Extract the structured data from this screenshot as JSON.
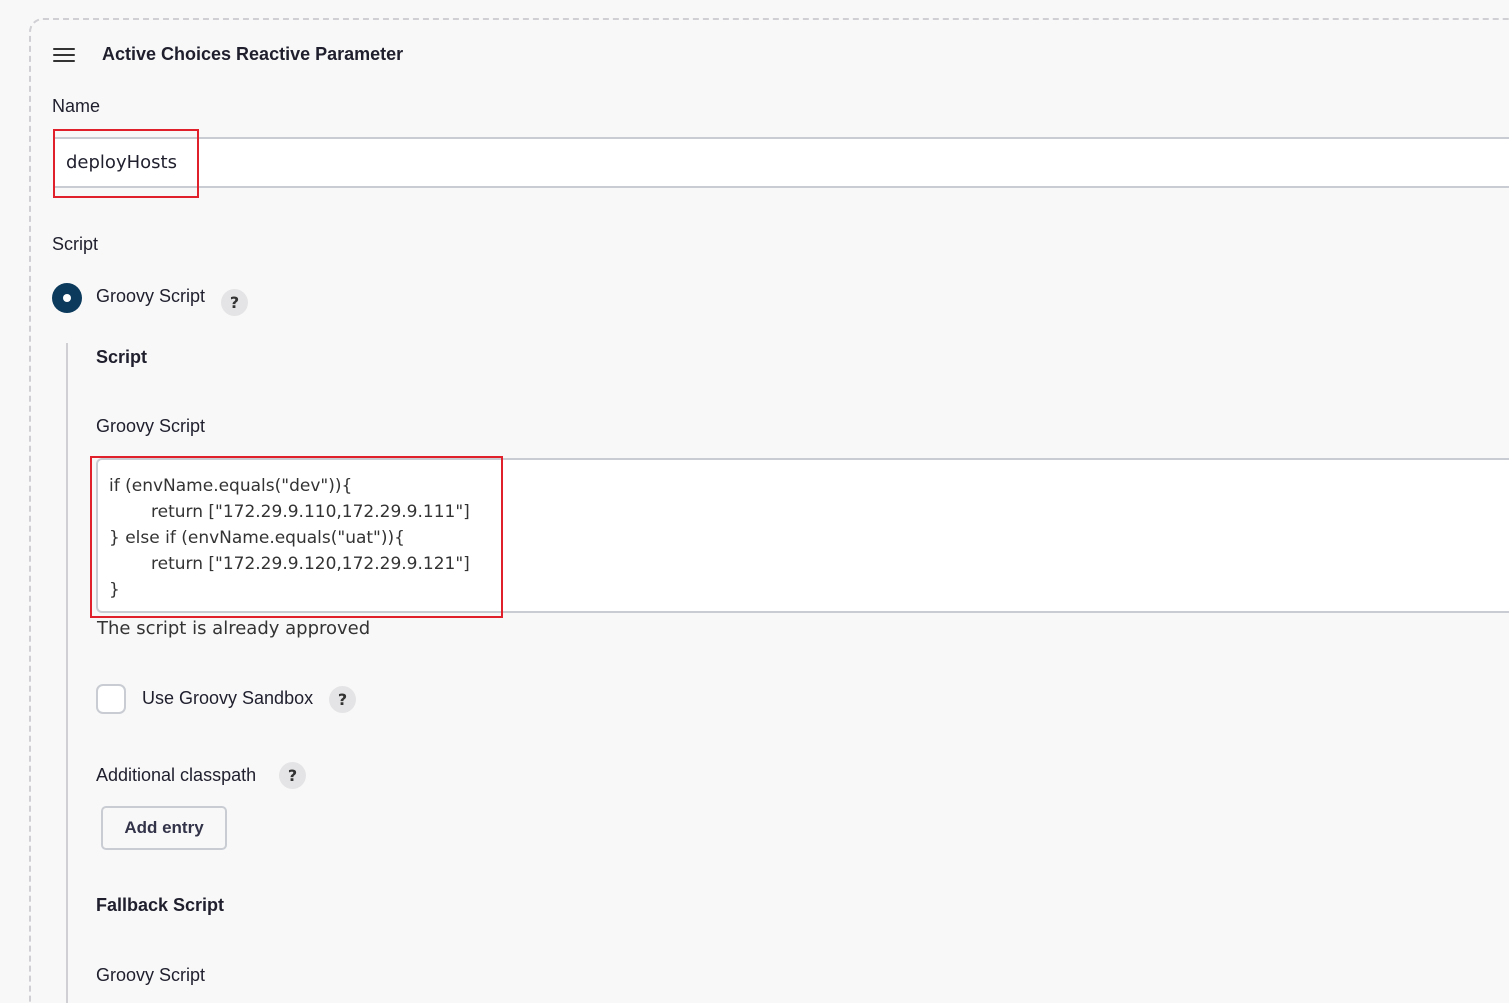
{
  "header": {
    "title": "Active Choices Reactive Parameter",
    "drag_icon": "hamburger-icon"
  },
  "name_field": {
    "label": "Name",
    "value": "deployHosts"
  },
  "script_section": {
    "label": "Script",
    "radio_label": "Groovy Script",
    "help_glyph": "?"
  },
  "groovy": {
    "section_title": "Script",
    "field_label": "Groovy Script",
    "code_lines": [
      "if (envName.equals(\"dev\")){",
      "return [\"172.29.9.110,172.29.9.111\"]",
      "} else if (envName.equals(\"uat\")){",
      "return [\"172.29.9.120,172.29.9.121\"]",
      "}"
    ],
    "approval_status": "The script is already approved",
    "sandbox_label": "Use Groovy Sandbox",
    "classpath_label": "Additional classpath",
    "add_entry_label": "Add entry"
  },
  "fallback": {
    "section_title": "Fallback Script",
    "field_label": "Groovy Script"
  },
  "colors": {
    "highlight": "#e0202a",
    "radio_selected": "#0b3a5c"
  }
}
